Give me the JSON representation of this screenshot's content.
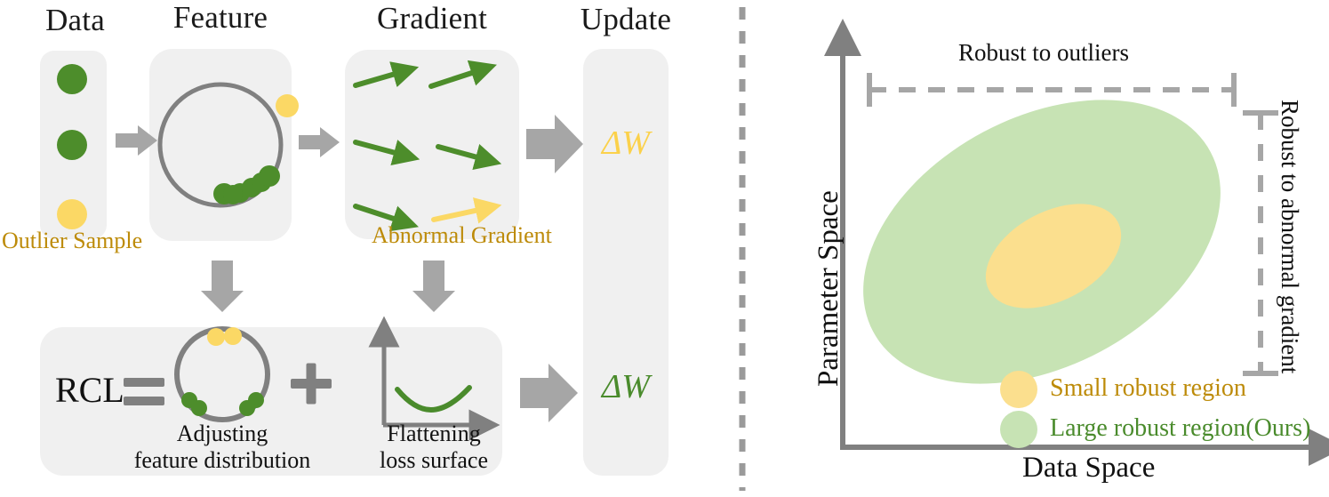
{
  "figure": {
    "type": "diagram",
    "left_panel": {
      "column_titles": [
        "Data",
        "Feature",
        "Gradient",
        "Update"
      ],
      "data_stage": {
        "samples": [
          {
            "color": "#4d8d2b",
            "kind": "normal"
          },
          {
            "color": "#4d8d2b",
            "kind": "normal"
          },
          {
            "color": "#fbd865",
            "kind": "outlier"
          }
        ],
        "caption": "Outlier Sample",
        "caption_color": "#bd8b09"
      },
      "feature_stage": {
        "circle_stroke": "#808080",
        "inlier_color": "#4d8d2b",
        "outlier_color": "#fbd865",
        "inlier_count": 6,
        "outlier_count": 1,
        "note": "inliers collapsed on lower-right arc, outlier outside circle"
      },
      "gradient_stage": {
        "arrow_count": 6,
        "normal_color": "#4d8d2b",
        "abnormal_color": "#fbd865",
        "caption": "Abnormal Gradient",
        "caption_color": "#bd8b09"
      },
      "update_stage": {
        "top_label": "ΔW",
        "top_color": "#fbd14b",
        "bottom_label": "ΔW",
        "bottom_color": "#4a8b2c"
      },
      "rcl_row": {
        "name": "RCL",
        "equals": "=",
        "plus": "+",
        "term1_caption_line1": "Adjusting",
        "term1_caption_line2": "feature distribution",
        "term2_caption_line1": "Flattening",
        "term2_caption_line2": "loss surface",
        "term1_circle": {
          "outlier_color": "#fbd865",
          "outlier_count": 2,
          "inlier_color": "#4d8d2b",
          "inlier_count": 4
        },
        "term2_curve_color": "#4a8b2c"
      }
    },
    "right_panel": {
      "x_axis_label": "Data Space",
      "y_axis_label": "Parameter Space",
      "axis_color": "#808080",
      "bracket_top_label": "Robust to outliers",
      "bracket_right_label": "Robust to abnormal gradient",
      "bracket_color": "#a6a6a6",
      "regions": [
        {
          "name": "Small robust region",
          "color": "#fbdf8e",
          "text_color": "#bd8b09"
        },
        {
          "name": "Large robust region(Ours)",
          "color": "#c7e3b4",
          "text_color": "#4a8b2c"
        }
      ],
      "legend": [
        {
          "swatch_color": "#fbdf8e",
          "label": "Small robust region",
          "text_color": "#bd8b09"
        },
        {
          "swatch_color": "#c7e3b4",
          "label": "Large robust region(Ours)",
          "text_color": "#4a8b2c"
        }
      ]
    },
    "divider": {
      "orientation": "vertical",
      "style": "dashed",
      "color": "#9a9a9a"
    }
  }
}
